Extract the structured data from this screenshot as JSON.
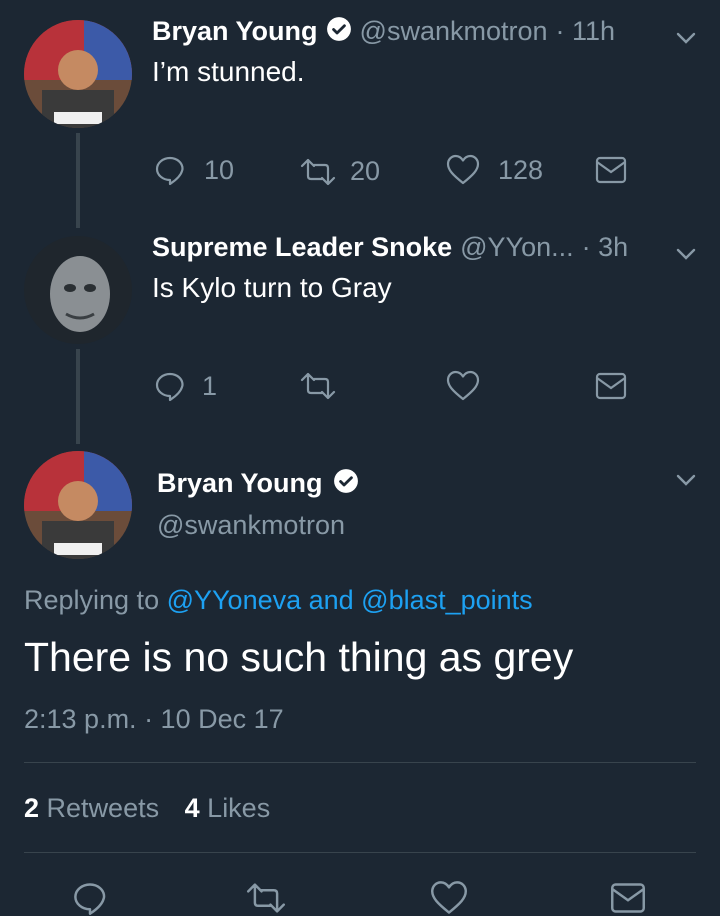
{
  "colors": {
    "background": "#1c2733",
    "text_primary": "#ffffff",
    "text_secondary": "#8899a6",
    "link": "#1da1f2",
    "divider": "#38444d"
  },
  "tweet1": {
    "name": "Bryan Young",
    "handle": "@swankmotron",
    "time": "· 11h",
    "text": "I’m stunned.",
    "replies": "10",
    "retweets": "20",
    "likes": "128"
  },
  "tweet2": {
    "name": "Supreme Leader Snoke",
    "handle": "@YYon...",
    "time": "· 3h",
    "text": "Is Kylo turn to Gray",
    "replies": "1"
  },
  "main_tweet": {
    "name": "Bryan Young",
    "handle": "@swankmotron",
    "replying_prefix": "Replying to",
    "replying_users": "@YYoneva and @blast_points",
    "text": "There is no such thing as grey",
    "timestamp": "2:13 p.m. · 10 Dec 17",
    "retweet_count": "2",
    "retweet_label": "Retweets",
    "like_count": "4",
    "like_label": "Likes"
  },
  "icons": {
    "reply": "reply-icon",
    "retweet": "retweet-icon",
    "like": "heart-icon",
    "message": "envelope-icon",
    "menu": "chevron-down-icon",
    "verified": "verified-badge-icon"
  }
}
